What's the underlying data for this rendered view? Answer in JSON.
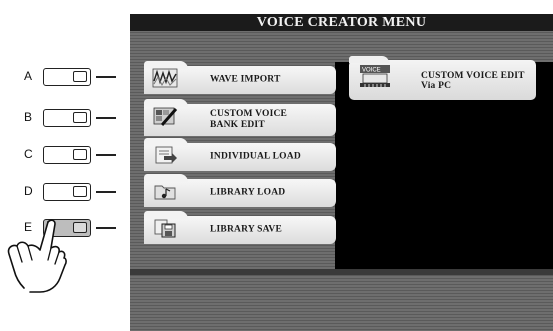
{
  "screen": {
    "title": "VOICE CREATOR MENU"
  },
  "menu_items": [
    {
      "letter": "A",
      "label": "WAVE IMPORT"
    },
    {
      "letter": "B",
      "label": "CUSTOM VOICE\nBANK EDIT"
    },
    {
      "letter": "C",
      "label": "INDIVIDUAL LOAD"
    },
    {
      "letter": "D",
      "label": "LIBRARY LOAD"
    },
    {
      "letter": "E",
      "label": "LIBRARY SAVE"
    }
  ],
  "right_item": {
    "label": "CUSTOM VOICE EDIT\nVia PC",
    "badge": "VOICE"
  },
  "pressed_button": "E",
  "icons": [
    "waveform-icon",
    "palette-brush-icon",
    "folder-arrow-icon",
    "folder-note-icon",
    "floppy-save-icon",
    "keyboard-pc-icon",
    "pointing-hand-icon"
  ]
}
